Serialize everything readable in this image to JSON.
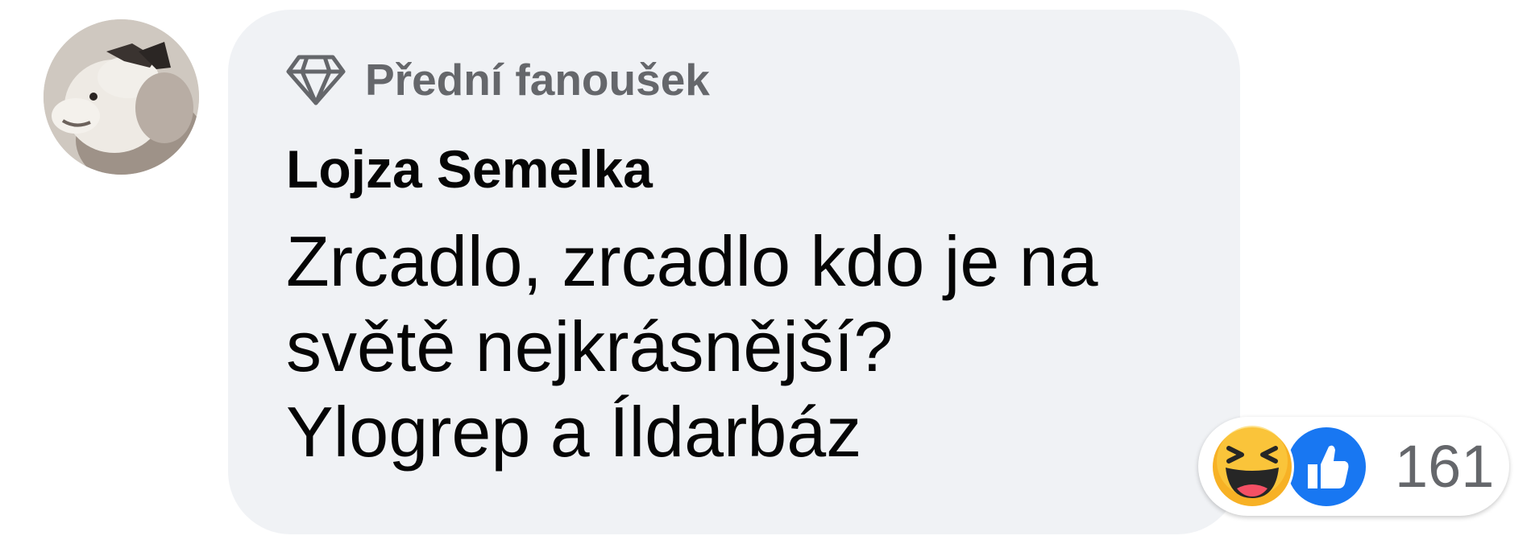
{
  "comment": {
    "avatar_icon": "alpaca-avatar",
    "badge": {
      "icon": "diamond-icon",
      "label": "Přední fanoušek"
    },
    "author": "Lojza Semelka",
    "text_lines": [
      "Zrcadlo, zrcadlo kdo je na",
      "světě nejkrásnější?",
      "Ylogrep a Íldarbáz"
    ],
    "reactions": {
      "icons": [
        "haha-reaction-icon",
        "like-reaction-icon"
      ],
      "count": "161"
    }
  },
  "colors": {
    "bubble_bg": "#f0f2f5",
    "secondary_text": "#65676b",
    "primary_text": "#050505",
    "like_blue": "#1877f2",
    "haha_yellow": "#f7b125"
  }
}
